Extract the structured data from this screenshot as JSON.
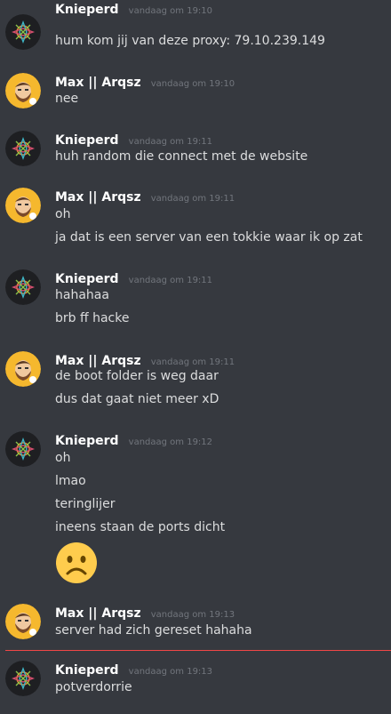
{
  "users": {
    "knieperd": "Knieperd",
    "max": "Max || Arqsz"
  },
  "colors": {
    "background": "#36393f",
    "username": "#ffffff",
    "timestamp": "#72767d",
    "text": "#dcddde",
    "new_messages_divider": "#f04747"
  },
  "messages": [
    {
      "author": "Knieperd",
      "avatar": "knieperd-avatar-icon",
      "timestamp": "vandaag om 19:10",
      "lines": [
        "hum kom jij van deze proxy: 79.10.239.149"
      ]
    },
    {
      "author": "Max || Arqsz",
      "avatar": "max-avatar-icon",
      "timestamp": "vandaag om 19:10",
      "lines": [
        "nee"
      ]
    },
    {
      "author": "Knieperd",
      "avatar": "knieperd-avatar-icon",
      "timestamp": "vandaag om 19:11",
      "lines": [
        "huh random die connect met de website"
      ]
    },
    {
      "author": "Max || Arqsz",
      "avatar": "max-avatar-icon",
      "timestamp": "vandaag om 19:11",
      "lines": [
        "oh",
        "ja dat is een server van een tokkie waar ik op zat"
      ]
    },
    {
      "author": "Knieperd",
      "avatar": "knieperd-avatar-icon",
      "timestamp": "vandaag om 19:11",
      "lines": [
        "hahahaa",
        "brb ff hacke"
      ]
    },
    {
      "author": "Max || Arqsz",
      "avatar": "max-avatar-icon",
      "timestamp": "vandaag om 19:11",
      "lines": [
        "de boot folder is weg daar",
        "dus  dat gaat niet meer xD"
      ]
    },
    {
      "author": "Knieperd",
      "avatar": "knieperd-avatar-icon",
      "timestamp": "vandaag om 19:12",
      "lines": [
        "oh",
        "lmao",
        "teringlijer",
        "ineens staan de ports dicht"
      ],
      "emoji": "frowning-face-emoji-icon"
    },
    {
      "author": "Max || Arqsz",
      "avatar": "max-avatar-icon",
      "timestamp": "vandaag om 19:13",
      "lines": [
        "server had zich gereset hahaha"
      ]
    },
    {
      "author": "Knieperd",
      "avatar": "knieperd-avatar-icon",
      "timestamp": "vandaag om 19:13",
      "lines": [
        "potverdorrie"
      ]
    }
  ]
}
